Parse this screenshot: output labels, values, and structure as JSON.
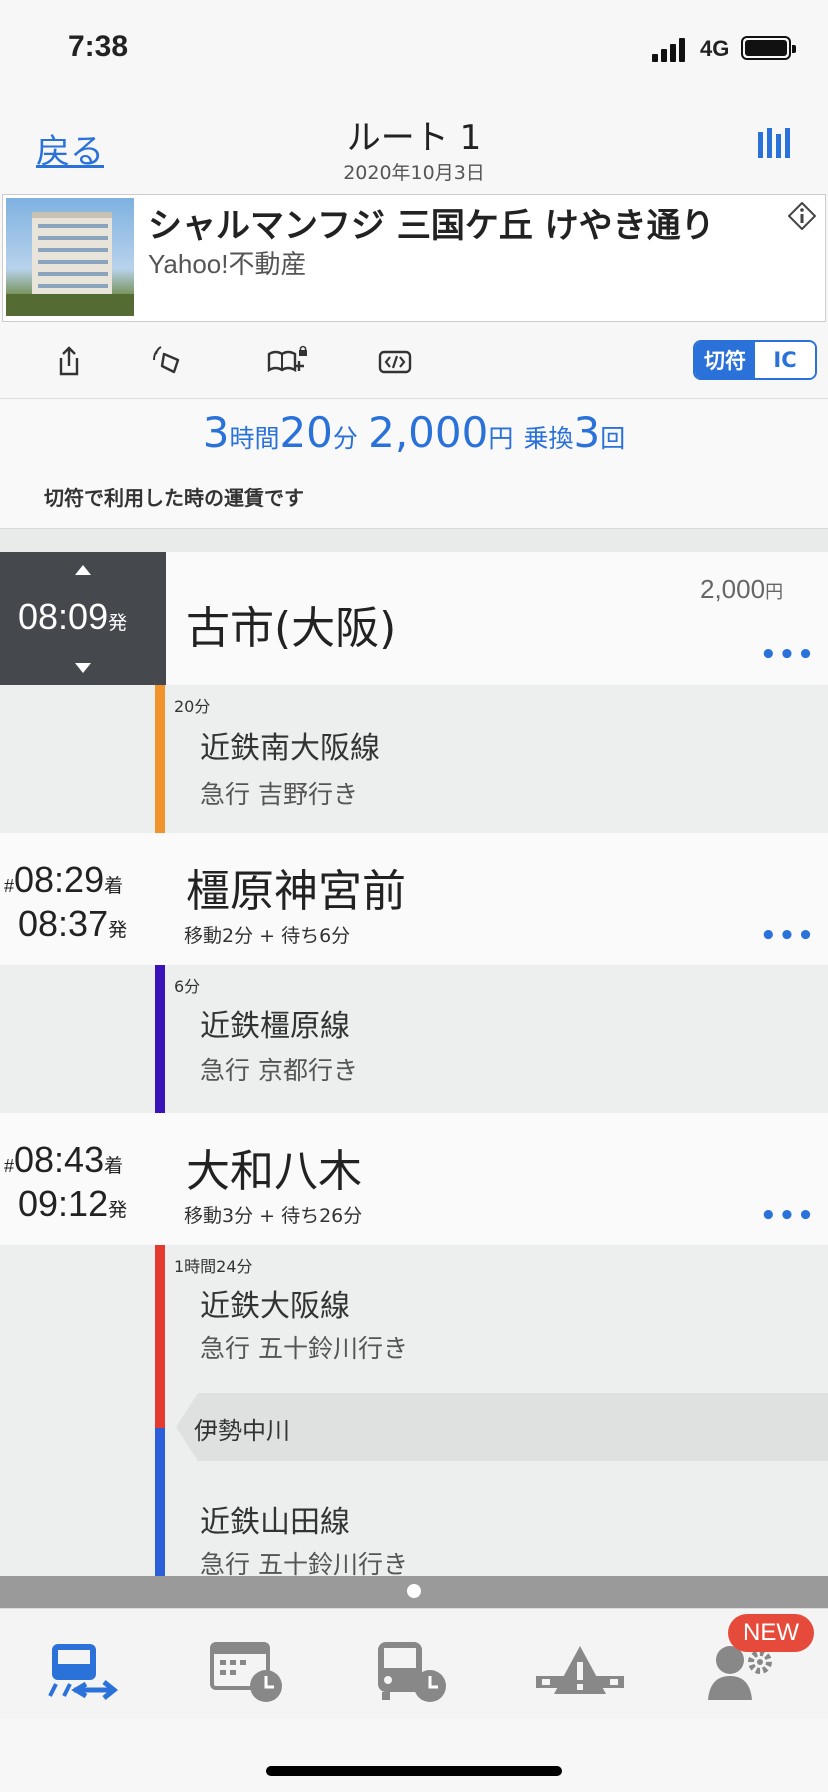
{
  "status": {
    "time": "7:38",
    "network": "4G"
  },
  "nav": {
    "back_label": "戻る",
    "title": "ルート 1",
    "date": "2020年10月3日"
  },
  "ad": {
    "title": "シャルマンフジ 三国ケ丘 けやき通り",
    "source": "Yahoo!不動産"
  },
  "toolbar": {
    "icons": [
      "share-icon",
      "alarm-icon",
      "bookmark-add-icon",
      "code-embed-icon"
    ],
    "fare_ticket": "切符",
    "fare_ic": "IC"
  },
  "summary": {
    "h_num": "3",
    "h_unit": "時間",
    "m_num": "20",
    "m_unit": "分",
    "fare_num": "2,000",
    "fare_unit": "円",
    "transfer_label": "乗換",
    "transfer_num": "3",
    "transfer_unit": "回",
    "note": "切符で利用した時の運賃です"
  },
  "route": {
    "start": {
      "time": "08:09",
      "suffix": "発",
      "station": "古市(大阪)",
      "fare": "2,000",
      "fare_unit": "円"
    },
    "seg1": {
      "duration": "20分",
      "line": "近鉄南大阪線",
      "dest": "急行 吉野行き",
      "color": "#f0932b"
    },
    "st2": {
      "mark": "#",
      "arr": "08:29",
      "arr_suffix": "着",
      "dep": "08:37",
      "dep_suffix": "発",
      "station": "橿原神宮前",
      "sub": "移動2分 + 待ち6分"
    },
    "seg2": {
      "duration": "6分",
      "line": "近鉄橿原線",
      "dest": "急行 京都行き",
      "color": "#3a14b8"
    },
    "st3": {
      "mark": "#",
      "arr": "08:43",
      "arr_suffix": "着",
      "dep": "09:12",
      "dep_suffix": "発",
      "station": "大和八木",
      "sub": "移動3分 + 待ち26分"
    },
    "seg3": {
      "duration": "1時間24分",
      "line": "近鉄大阪線",
      "dest": "急行 五十鈴川行き",
      "color": "#e53a2f"
    },
    "via": "伊勢中川",
    "seg4": {
      "line": "近鉄山田線",
      "dest": "急行 五十鈴川行き",
      "color": "#2a5fd9"
    },
    "more": "•••"
  },
  "tabs": {
    "items": [
      "route-search-icon",
      "timetable-icon",
      "bus-timetable-icon",
      "service-alert-icon",
      "settings-icon"
    ],
    "badge": "NEW"
  }
}
